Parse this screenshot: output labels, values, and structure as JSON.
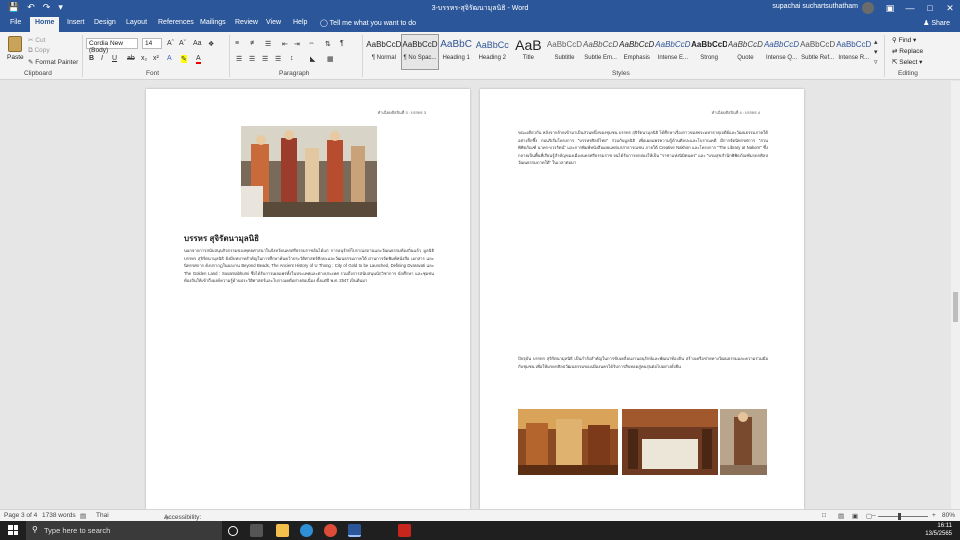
{
  "titlebar": {
    "title": "3-บรรหร-สุจิรัฒนามุลนิธิ - Word",
    "user": "supachai suchartsuthatham",
    "save_icon": "save-icon",
    "undo_icon": "undo-icon",
    "redo_icon": "redo-icon"
  },
  "tabs": [
    "File",
    "Home",
    "Insert",
    "Design",
    "Layout",
    "References",
    "Mailings",
    "Review",
    "View",
    "Help"
  ],
  "tellme": "Tell me what you want to do",
  "share": "Share",
  "ribbon": {
    "clipboard": {
      "label": "Clipboard",
      "paste": "Paste",
      "cut": "Cut",
      "copy": "Copy",
      "format_painter": "Format Painter"
    },
    "font": {
      "label": "Font",
      "name": "Cordia New (Body)",
      "size": "14"
    },
    "paragraph": {
      "label": "Paragraph"
    },
    "styles": {
      "label": "Styles",
      "items": [
        {
          "preview": "AaBbCcD",
          "name": "¶ Normal"
        },
        {
          "preview": "AaBbCcD",
          "name": "¶ No Spac..."
        },
        {
          "preview": "AaBbC",
          "name": "Heading 1"
        },
        {
          "preview": "AaBbCc",
          "name": "Heading 2"
        },
        {
          "preview": "AaB",
          "name": "Title"
        },
        {
          "preview": "AaBbCcD",
          "name": "Subtitle"
        },
        {
          "preview": "AaBbCcD",
          "name": "Subtle Em..."
        },
        {
          "preview": "AaBbCcD",
          "name": "Emphasis"
        },
        {
          "preview": "AaBbCcD",
          "name": "Intense E..."
        },
        {
          "preview": "AaBbCcD",
          "name": "Strong"
        },
        {
          "preview": "AaBbCcD",
          "name": "Quote"
        },
        {
          "preview": "AaBbCcD",
          "name": "Intense Q..."
        },
        {
          "preview": "AaBbCcD",
          "name": "Subtle Ref..."
        },
        {
          "preview": "AaBbCcD",
          "name": "Intense R..."
        }
      ]
    },
    "editing": {
      "label": "Editing",
      "find": "Find",
      "replace": "Replace",
      "select": "Select"
    }
  },
  "pages": {
    "left": {
      "header": "ทำเนียบศิลปินที่ 3 : บรรหร 3",
      "heading": "บรรหร สุจิรัตนามุลนิธิ",
      "body": "นอกจากการสนับสนุนกิจกรรมของพุทธศาสนาในจังหวัดนครศรีธรรมราชอันได้แก่ การอนุรักษ์โบราณสถานและวัฒนธรรมท้องถิ่นแล้ว มูลนิธิบรรหร สุจิรัตนามุลนิธิ ยังมีบทบาทสำคัญในการศึกษาค้นคว้าประวัติศาสตร์ศิลปะและวัฒนธรรมภาคใต้ ผ่านการจัดพิมพ์หนังสือ เอกสาร และนิทรรศการ ดังปรากฏในผลงาน Beyond Beads, The Ancient History of U Thong : City of Gold to be Launched, Defining Dvaravati และ The Golden Land : Suvarnabhumi ซึ่งได้รับการเผยแพร่ทั้งในประเทศและต่างประเทศ รวมถึงการสนับสนุนนักวิชาการ นักศึกษา และชุมชนท้องถิ่นให้เข้าถึงองค์ความรู้ด้านประวัติศาสตร์และโบราณคดีอย่างต่อเนื่อง ตั้งแต่ปี พ.ศ. 2547 เป็นต้นมา"
    },
    "right": {
      "header": "ทำเนียบศิลปินที่ 4 : บรรหร 4",
      "body_1": "ขณะเดียวกัน หลังจากย้ายเข้ามาเป็นส่วนหนึ่งของชุมชน บรรหร สุจิรัตนามุลนิธิ ได้ศึกษาเรื่องราวของพระมหาธาตุเจดีย์และวัฒนธรรมภาคใต้อย่างลึกซึ้ง ก่อนริเริ่มโครงการ \"บรรหรศิลป์ไทย\" ร่วมกับมูลนิธิ เพื่อเผยแพร่ความรู้ด้านศิลปะและโบราณคดี มีการจัดนิทรรศการ \"สวนพิพิธภัณฑ์ นาคร-บวรรัตน์\" และการพิมพ์หนังสือเผยแพร่แก่สาธารณชน ภายใต้ Creative Nakhon และโครงการ \"The Library at Nakorn\" ซึ่งกลายเป็นพื้นที่เรียนรู้สำคัญของเมืองนครศรีธรรมราช จนได้รับการยกย่องให้เป็น \"ราชาแห่งนิมิตนคร\" และ \"บรมสุขสำนักพิพิธภัณฑ์มรดกศิลปวัฒนธรรมภาคใต้\" ในเวลาต่อมา",
      "body_2": "ปัจจุบัน บรรหร สุจิรัตนามุลนิธิ เป็นกำลังสำคัญในการขับเคลื่อนงานอนุรักษ์และพัฒนาท้องถิ่น สร้างเครือข่ายทางวัฒนธรรมและความร่วมมือกับชุมชน เพื่อให้มรดกศิลปวัฒนธรรมของเมืองนครได้รับการสืบทอดสู่คนรุ่นต่อไปอย่างยั่งยืน"
    }
  },
  "status": {
    "page": "Page 3 of 4",
    "words": "1738 words",
    "language": "Thai",
    "accessibility": "Accessibility: Investigate",
    "zoom": "80%"
  },
  "taskbar": {
    "search_placeholder": "Type here to search",
    "time": "16:11",
    "date": "13/5/2565",
    "apps": [
      "task-view-icon",
      "file-explorer-icon",
      "edge-icon",
      "chrome-icon",
      "firefox-icon",
      "word-icon",
      "pdf-icon"
    ]
  },
  "colors": {
    "word_blue": "#2b579a",
    "taskbar": "#1f1f1f"
  }
}
